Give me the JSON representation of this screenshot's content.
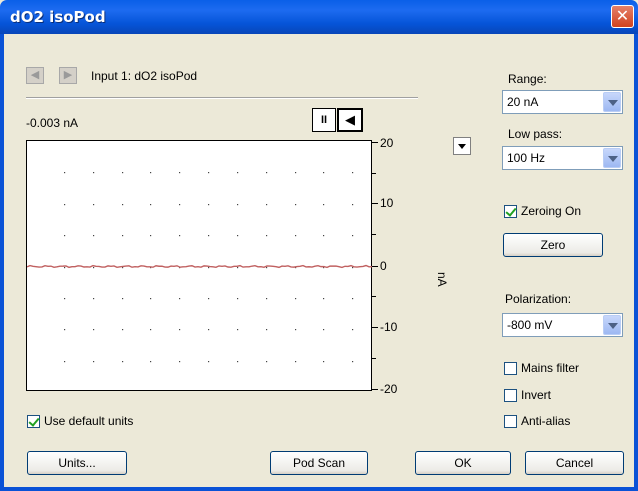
{
  "window": {
    "title": "dO2 isoPod",
    "close_glyph": "✕"
  },
  "input": {
    "label": "Input 1: dO2 isoPod",
    "back_glyph": "◀",
    "forward_glyph": "▶"
  },
  "readout": {
    "value": "-0.003 nA"
  },
  "plot": {
    "pause_glyph": "II",
    "scroll_glyph": "◀",
    "unit_label": "nA",
    "y_ticks": [
      "20",
      "10",
      "0",
      "-10",
      "-20"
    ],
    "ylim": [
      -20,
      20
    ],
    "signal_value": 0,
    "signal_color": "#c06060",
    "grid": "dotted"
  },
  "range": {
    "label": "Range:",
    "value": "20 nA"
  },
  "lowpass": {
    "label": "Low pass:",
    "value": "100 Hz"
  },
  "zeroing": {
    "label": "Zeroing On",
    "checked": true
  },
  "zero_button": {
    "label": "Zero"
  },
  "polarization": {
    "label": "Polarization:",
    "value": "-800 mV"
  },
  "mains_filter": {
    "label": "Mains filter",
    "checked": false
  },
  "invert": {
    "label": "Invert",
    "checked": false
  },
  "anti_alias": {
    "label": "Anti-alias",
    "checked": false
  },
  "default_units": {
    "label": "Use default units",
    "checked": true
  },
  "buttons": {
    "units": "Units...",
    "pod_scan": "Pod Scan",
    "ok": "OK",
    "cancel": "Cancel"
  }
}
